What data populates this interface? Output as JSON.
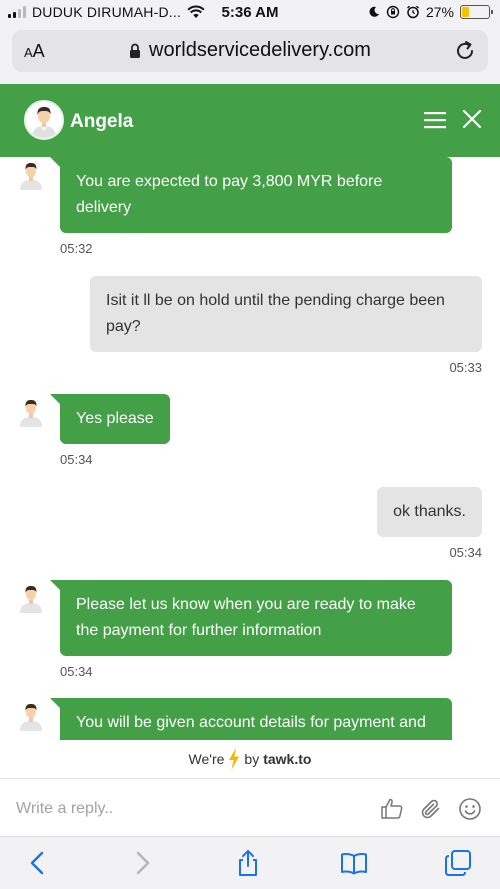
{
  "status_bar": {
    "carrier": "DUDUK DIRUMAH-D...",
    "time": "5:36 AM",
    "battery": "27%",
    "battery_level": 0.27
  },
  "browser": {
    "aa_label": "AA",
    "url": "worldservicedelivery.com"
  },
  "chat": {
    "agent_name": "Angela",
    "messages": [
      {
        "sender": "agent",
        "text": "You are expected to pay 3,800 MYR before delivery",
        "time": "05:32"
      },
      {
        "sender": "visitor",
        "text": "Isit it ll be on hold until the pending charge been pay?",
        "time": "05:33"
      },
      {
        "sender": "agent",
        "text": "Yes please",
        "time": "05:34"
      },
      {
        "sender": "visitor",
        "text": "ok thanks.",
        "time": "05:34"
      },
      {
        "sender": "agent",
        "text": "Please let us know when you are ready to make the payment for further information",
        "time": "05:34"
      },
      {
        "sender": "agent",
        "text": "You will be given account details for payment and",
        "time": ""
      }
    ]
  },
  "powered_by": {
    "prefix": "We're",
    "middle": "by",
    "brand": "tawk.to"
  },
  "reply": {
    "placeholder": "Write a reply.."
  },
  "colors": {
    "accent": "#43a047",
    "visitor_bubble": "#e4e4e4",
    "ios_blue": "#1a73e8"
  }
}
